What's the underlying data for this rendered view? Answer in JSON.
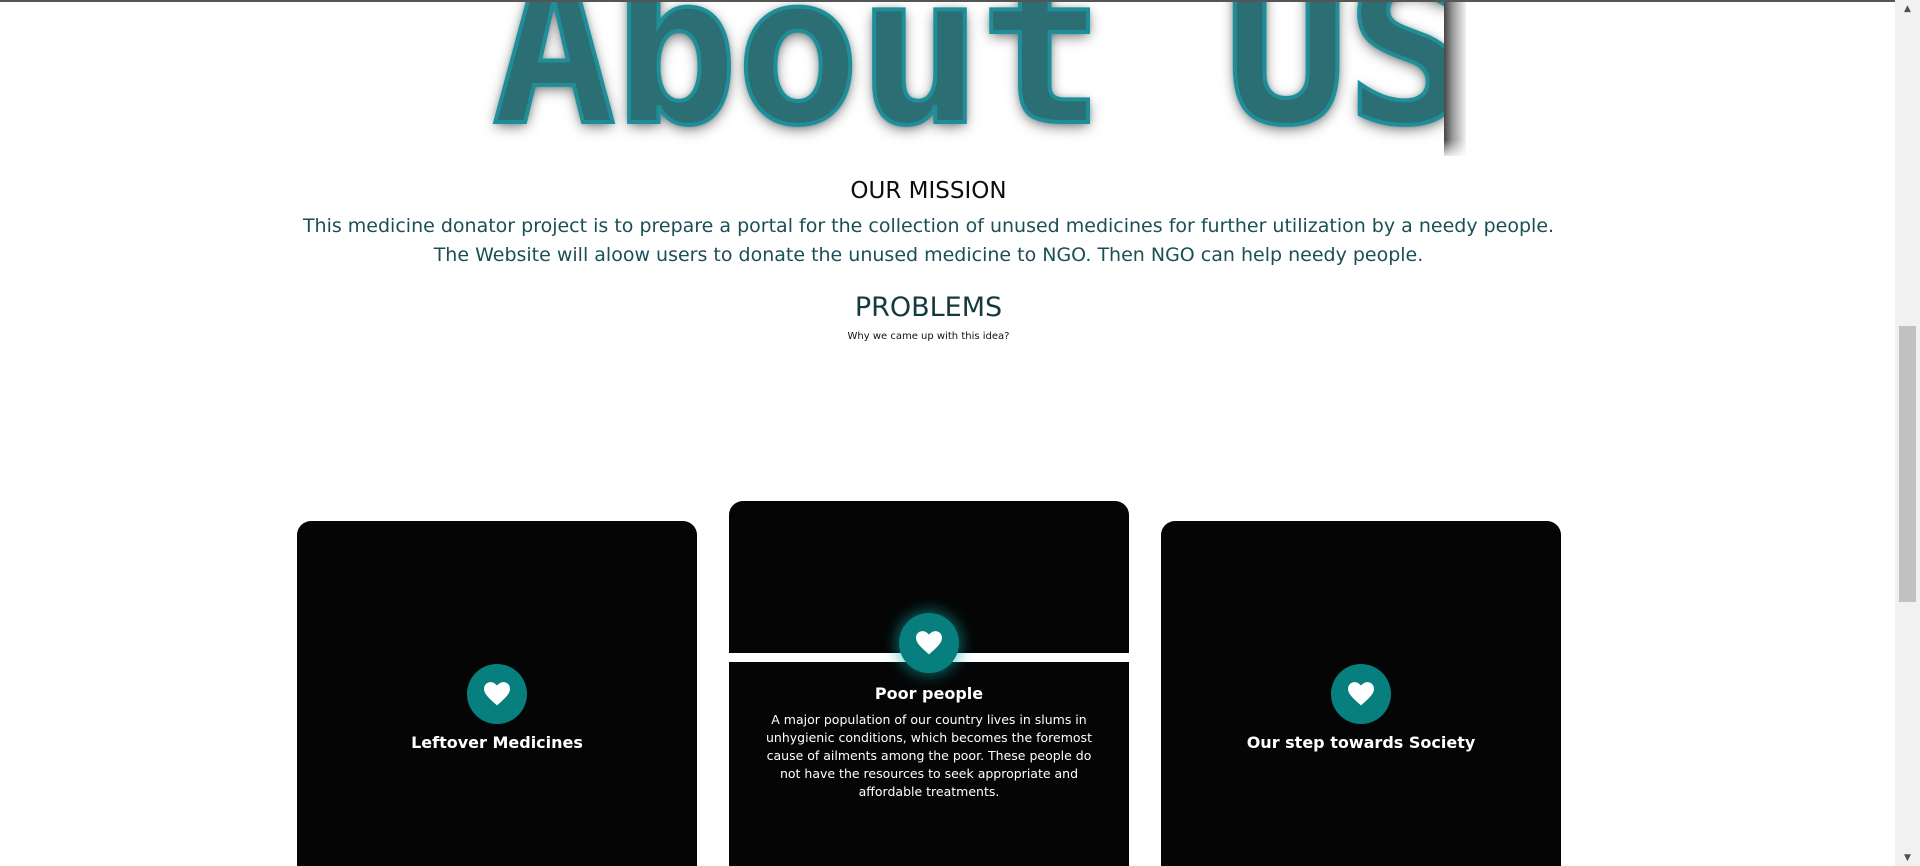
{
  "hero": {
    "image_text": "About US"
  },
  "mission": {
    "title": "OUR MISSION",
    "line1": "This medicine donator project is to prepare a portal for the collection of unused medicines for further utilization by a needy people.",
    "line2": "The Website will aloow users to donate the unused medicine to NGO. Then NGO can help needy people."
  },
  "problems": {
    "title": "PROBLEMS",
    "subtitle": "Why we came up with this idea?"
  },
  "cards": [
    {
      "title": "Leftover Medicines",
      "icon": "heart-icon"
    },
    {
      "title": "Poor people",
      "icon": "heart-icon",
      "text": "A major population of our country lives in slums in unhygienic conditions, which becomes the foremost cause of ailments among the poor. These people do not have the resources to seek appropriate and affordable treatments."
    },
    {
      "title": "Our step towards Society",
      "icon": "heart-icon"
    }
  ],
  "colors": {
    "accent": "#087f7f",
    "card_bg": "#050505",
    "mission_text": "#1a4f55"
  },
  "scrollbar": {
    "up_arrow": "▲",
    "down_arrow": "▼"
  }
}
